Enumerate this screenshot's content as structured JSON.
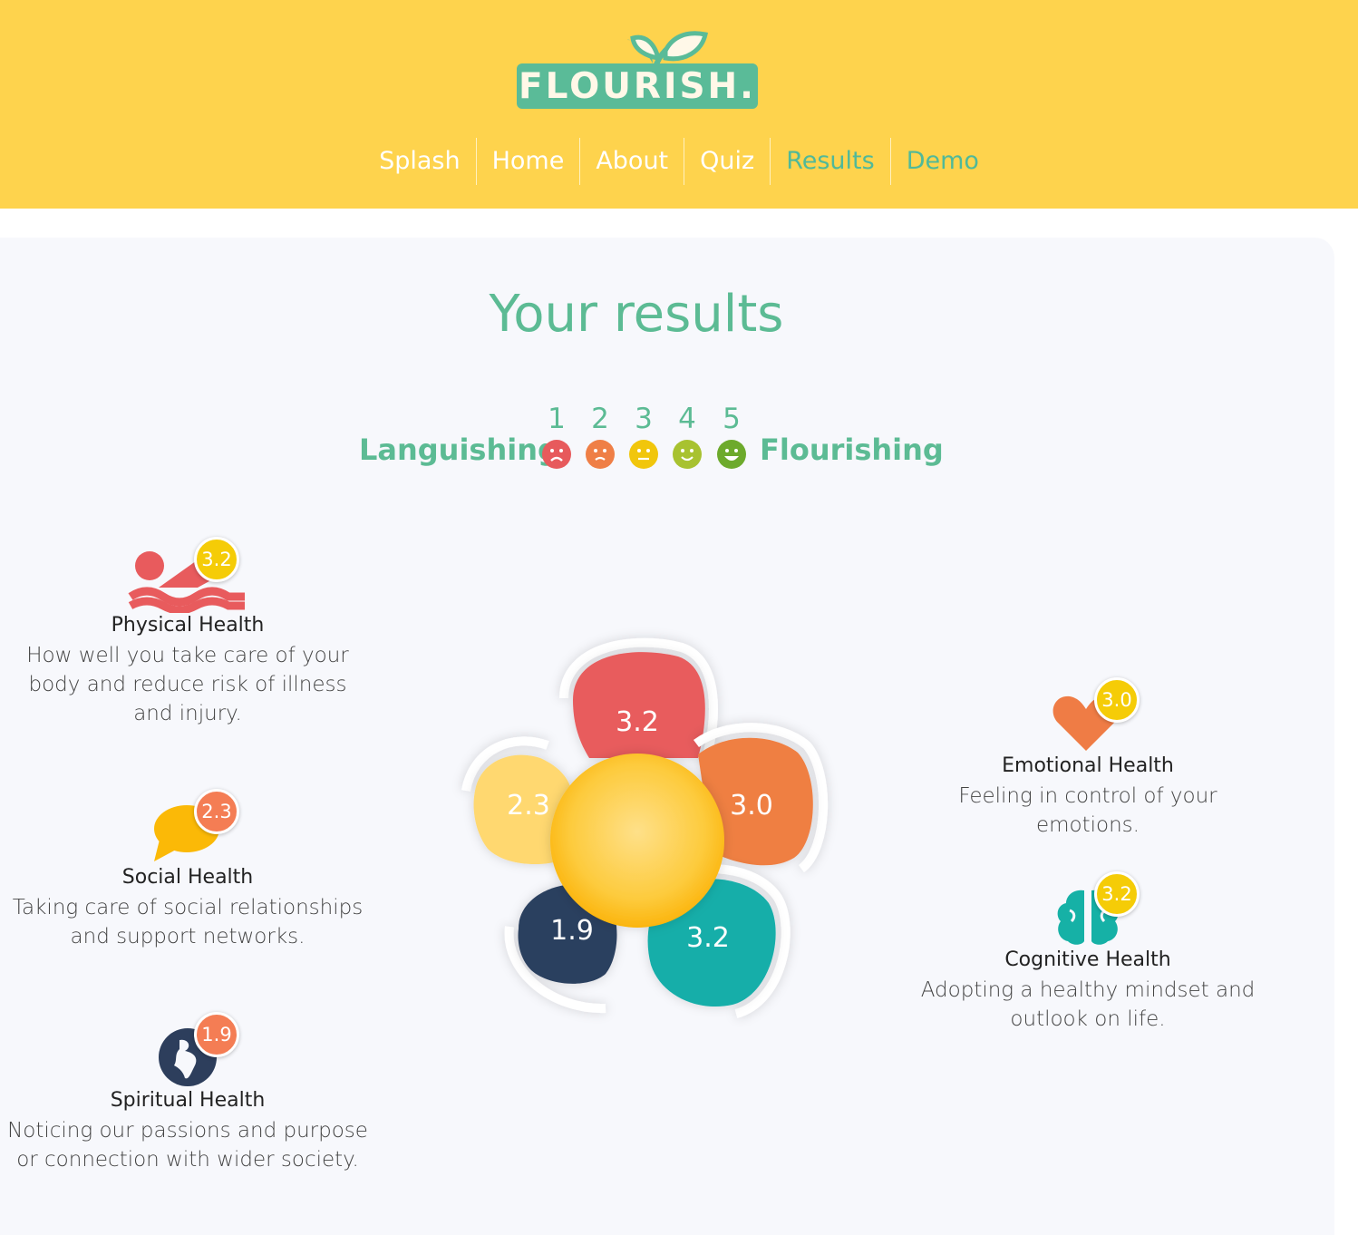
{
  "header": {
    "logo_text": "FLOURISH.",
    "nav": [
      {
        "label": "Splash",
        "active": false
      },
      {
        "label": "Home",
        "active": false
      },
      {
        "label": "About",
        "active": false
      },
      {
        "label": "Quiz",
        "active": false
      },
      {
        "label": "Results",
        "active": true
      },
      {
        "label": "Demo",
        "active": true
      }
    ]
  },
  "results": {
    "title": "Your results",
    "scale": {
      "low_label": "Languishing",
      "high_label": "Flourishing",
      "levels": [
        "1",
        "2",
        "3",
        "4",
        "5"
      ],
      "face_icons": [
        "very-sad-face-icon",
        "sad-face-icon",
        "neutral-face-icon",
        "smile-face-icon",
        "grin-face-icon"
      ],
      "face_colors": [
        "#e75a5c",
        "#ef7f46",
        "#f1c60c",
        "#a8c230",
        "#6daa2c"
      ]
    },
    "categories": {
      "physical": {
        "name": "Physical Health",
        "score": "3.2",
        "icon": "swimmer-icon",
        "color": "#e85b5d",
        "badge_color": "#f5cc07",
        "description": "How well you take care of your body and reduce risk of illness and injury."
      },
      "social": {
        "name": "Social Health",
        "score": "2.3",
        "icon": "speech-bubble-icon",
        "color": "#fbb907",
        "badge_color": "#f47d54",
        "description": "Taking care of social relationships and support networks."
      },
      "spiritual": {
        "name": "Spiritual Health",
        "score": "1.9",
        "icon": "globe-icon",
        "color": "#2d3e5c",
        "badge_color": "#f47d54",
        "description": "Noticing our passions and purpose or connection with wider society."
      },
      "emotional": {
        "name": "Emotional Health",
        "score": "3.0",
        "icon": "heart-icon",
        "color": "#ef7c45",
        "badge_color": "#f5cc07",
        "description": "Feeling in control of your emotions."
      },
      "cognitive": {
        "name": "Cognitive Health",
        "score": "3.2",
        "icon": "brain-icon",
        "color": "#16b1a6",
        "badge_color": "#f5cc07",
        "description": "Adopting a healthy mindset and outlook on life."
      }
    },
    "flower": {
      "petals": [
        {
          "id": "physical",
          "value": "3.2",
          "color": "#e85b5d"
        },
        {
          "id": "emotional",
          "value": "3.0",
          "color": "#ef7f42"
        },
        {
          "id": "cognitive",
          "value": "3.2",
          "color": "#13aea9"
        },
        {
          "id": "spiritual",
          "value": "1.9",
          "color": "#2b3f5e"
        },
        {
          "id": "social",
          "value": "2.3",
          "color": "#ffd86f"
        }
      ],
      "center_color": "#fdc833"
    }
  }
}
